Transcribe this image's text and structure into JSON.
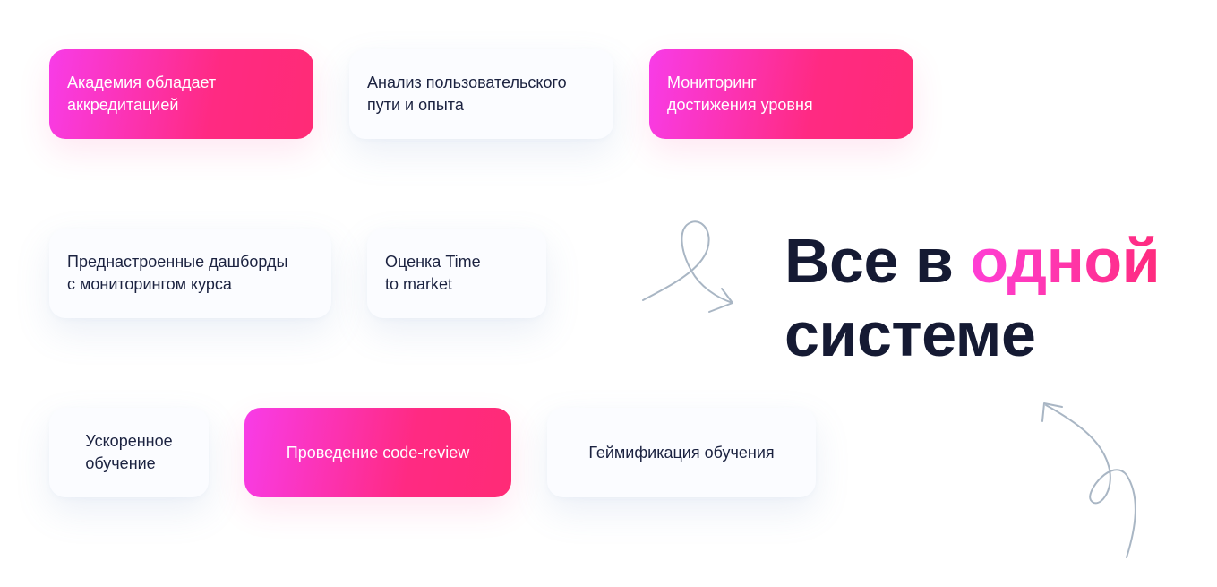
{
  "cards": [
    {
      "id": "accreditation",
      "text": "Академия обладает\nаккредитацией",
      "style": "pink"
    },
    {
      "id": "user-journey",
      "text": "Анализ пользовательского\nпути и опыта",
      "style": "light"
    },
    {
      "id": "level-monitoring",
      "text": "Мониторинг\nдостижения уровня",
      "style": "pink"
    },
    {
      "id": "dashboards",
      "text": "Преднастроенные дашборды\nс мониторингом курса",
      "style": "light"
    },
    {
      "id": "time-to-market",
      "text": "Оценка Time\nto market",
      "style": "light"
    },
    {
      "id": "fast-learning",
      "text": "Ускоренное\nобучение",
      "style": "light"
    },
    {
      "id": "code-review",
      "text": "Проведение code-review",
      "style": "pink"
    },
    {
      "id": "gamification",
      "text": "Геймификация обучения",
      "style": "light"
    }
  ],
  "headline": {
    "part1": "Все в ",
    "highlight": "одной",
    "part2": "системе"
  },
  "colors": {
    "accent_start": "#f83ce8",
    "accent_end": "#ff2b76",
    "text_dark": "#151a33",
    "arrow": "#a9b6c4"
  }
}
